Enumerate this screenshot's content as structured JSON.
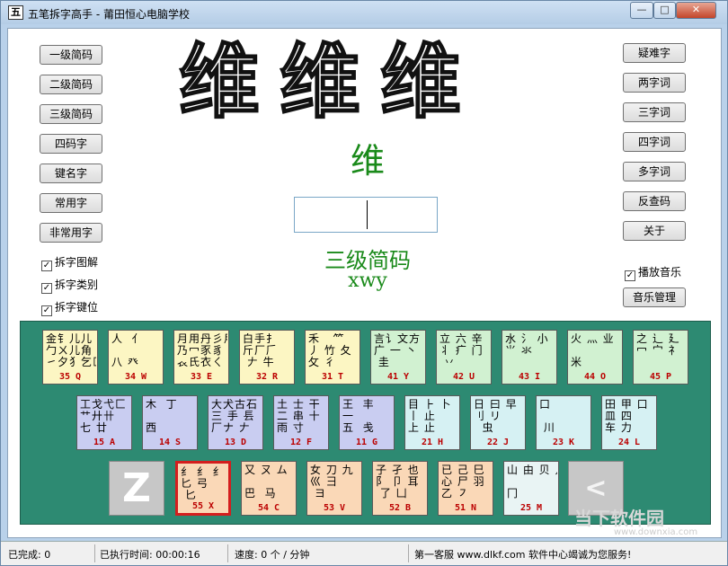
{
  "window": {
    "title": "五笔拆字高手 - 莆田恒心电脑学校",
    "icon_label": "五",
    "minimize": "—",
    "maximize": "□",
    "close": "✕"
  },
  "left_buttons": [
    "一级简码",
    "二级简码",
    "三级简码",
    "四码字",
    "键名字",
    "常用字",
    "非常用字"
  ],
  "checkboxes": [
    {
      "label": "拆字图解",
      "checked": true
    },
    {
      "label": "拆字类别",
      "checked": true
    },
    {
      "label": "拆字键位",
      "checked": true
    }
  ],
  "right_buttons": [
    "疑难字",
    "两字词",
    "三字词",
    "四字词",
    "多字词",
    "反查码",
    "关于"
  ],
  "music": {
    "checkbox_label": "播放音乐",
    "checked": true,
    "manage_button": "音乐管理"
  },
  "display": {
    "big_chars": [
      "维",
      "维",
      "维"
    ],
    "char": "维",
    "input_value": "",
    "level": "三级简码",
    "code": "xwy"
  },
  "keyboard": {
    "rows": [
      [
        {
          "id": "key-q",
          "color": "y",
          "label": "35 Q",
          "radicals": "金钅儿儿\n勹ㄨ儿角\n㇀夕犭乞匚"
        },
        {
          "id": "key-w",
          "color": "y",
          "label": "34 W",
          "radicals": "人  亻\n\n八 癶 &nbsp;"
        },
        {
          "id": "key-e",
          "color": "y",
          "label": "33 E",
          "radicals": "月用丹彡用\n乃冖豕豸\n𧘇氏衣ㄑ"
        },
        {
          "id": "key-r",
          "color": "y",
          "label": "32 R",
          "radicals": "白手扌\n斤厂𠂆\n 𠂇 牛"
        },
        {
          "id": "key-t",
          "color": "y",
          "label": "31 T",
          "radicals": "禾   ⺮\n丿 竹 夂\n攵 彳"
        },
        {
          "id": "key-y",
          "color": "g",
          "label": "41 Y",
          "radicals": "言讠文方\n广 一 丶\n 圭"
        },
        {
          "id": "key-u",
          "color": "g",
          "label": "42 U",
          "radicals": "立 六 辛\n丬 疒 门\n 丷 "
        },
        {
          "id": "key-i",
          "color": "g",
          "label": "43 I",
          "radicals": "水 氵 小\n⺌ 氺 \n "
        },
        {
          "id": "key-o",
          "color": "g",
          "label": "44 O",
          "radicals": "火 灬 业\n \n米 "
        },
        {
          "id": "key-p",
          "color": "g",
          "label": "45 P",
          "radicals": "之 辶 廴\n冖 宀 礻\n "
        }
      ],
      [
        {
          "id": "key-a",
          "color": "b",
          "label": "15 A",
          "radicals": "工戈弋匚\n艹廾卄\n七 廿 "
        },
        {
          "id": "key-s",
          "color": "b",
          "label": "14 S",
          "radicals": "木  丁\n\n西  "
        },
        {
          "id": "key-d",
          "color": "b",
          "label": "13 D",
          "radicals": "大犬古石\n三 手 镸\n厂ナ 𠂇"
        },
        {
          "id": "key-f",
          "color": "b",
          "label": "12 F",
          "radicals": "土 士 干\n二 串 十\n雨 寸 "
        },
        {
          "id": "key-g",
          "color": "b",
          "label": "11 G",
          "radicals": "王  丰\n一  \n五  戋"
        },
        {
          "id": "key-h",
          "color": "c",
          "label": "21 H",
          "radicals": "目 ⺊ 卜\n丨 止 \n上 止 "
        },
        {
          "id": "key-j",
          "color": "c",
          "label": "22 J",
          "radicals": "日 曰 早\n刂 リ \n  虫"
        },
        {
          "id": "key-k",
          "color": "c",
          "label": "23 K",
          "radicals": "口\n\n 川 "
        },
        {
          "id": "key-l",
          "color": "c",
          "label": "24 L",
          "radicals": "田 甲 口\n皿 四 \n车 力 "
        }
      ],
      [
        {
          "id": "key-x",
          "color": "o",
          "label": "55 X",
          "radicals": "纟 纟 纟\n匕 弓 \n 匕",
          "selected": true
        },
        {
          "id": "key-c",
          "color": "o",
          "label": "54 C",
          "radicals": "又 ㄡ ム\n\n巴  马"
        },
        {
          "id": "key-v",
          "color": "o",
          "label": "53 V",
          "radicals": "女 刀 九\n巛 彐 \n ヨ "
        },
        {
          "id": "key-b",
          "color": "o",
          "label": "52 B",
          "radicals": "子 孑 也\n阝 卩 耳\n 了 凵"
        },
        {
          "id": "key-n",
          "color": "o",
          "label": "51 N",
          "radicals": "已 己 巳\n心 尸 羽\n乙 ㇇ "
        },
        {
          "id": "key-m",
          "color": "w",
          "label": "25 M",
          "radicals": "山 由 贝 几\n\n冂  "
        }
      ]
    ],
    "z_key": "Z",
    "punct_key": "<"
  },
  "status": {
    "done": "已完成: 0",
    "elapsed": "已执行时间: 00:00:16",
    "speed": "速度:  0 个 / 分钟",
    "promo": "第一客服 www.dlkf.com 软件中心竭诚为您服务!"
  },
  "watermark": {
    "text": "当下软件园",
    "url": "www.downxia.com"
  }
}
